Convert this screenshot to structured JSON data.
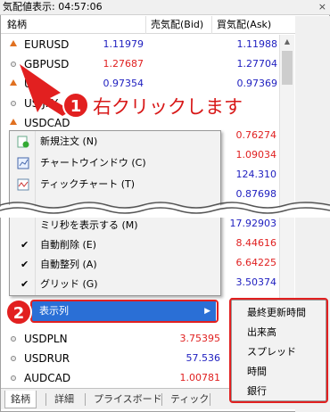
{
  "window": {
    "title": "気配値表示: 04:57:06",
    "close": "×"
  },
  "columns": {
    "symbol": "銘柄",
    "bid": "売気配(Bid)",
    "ask": "買気配(Ask)"
  },
  "rows": [
    {
      "sym": "EURUSD",
      "bid": "1.11979",
      "ask": "1.11988",
      "bidc": "blue",
      "askc": "blue",
      "ind": "up"
    },
    {
      "sym": "GBPUSD",
      "bid": "1.27687",
      "ask": "1.27704",
      "bidc": "red",
      "askc": "blue",
      "ind": "dot"
    },
    {
      "sym": "U",
      "bid": "0.97354",
      "ask": "0.97369",
      "bidc": "blue",
      "askc": "blue",
      "ind": "up"
    },
    {
      "sym": "US JPY",
      "bid": "",
      "ask": "",
      "bidc": "blue",
      "askc": "blue",
      "ind": "dot"
    },
    {
      "sym": "USDCAD",
      "bid": "",
      "ask": "",
      "bidc": "blue",
      "askc": "blue",
      "ind": "up"
    }
  ],
  "hidden_asks": [
    {
      "v": "0.76274",
      "c": "red"
    },
    {
      "v": "1.09034",
      "c": "red"
    },
    {
      "v": "124.310",
      "c": "blue"
    },
    {
      "v": "0.87698",
      "c": "blue"
    },
    {
      "v": "17.92903",
      "c": "blue"
    },
    {
      "v": "8.44616",
      "c": "red"
    },
    {
      "v": "6.64225",
      "c": "red"
    },
    {
      "v": "3.50374",
      "c": "blue"
    },
    {
      "v": "12.82025",
      "c": "red"
    }
  ],
  "lower_rows": [
    {
      "sym": "USDPLN",
      "bid": "3.75395",
      "bidc": "red",
      "grey": false
    },
    {
      "sym": "USDRUR",
      "bid": "57.536",
      "bidc": "blue",
      "grey": true
    },
    {
      "sym": "AUDCAD",
      "bid": "1.00781",
      "bidc": "red",
      "grey": false
    }
  ],
  "context_menu": {
    "new_order": "新規注文 (N)",
    "chart_window": "チャートウインドウ (C)",
    "tick_chart": "ティックチャート (T)",
    "show_ms": "ミリ秒を表示する (M)",
    "auto_remove": "自動削除 (E)",
    "auto_arrange": "自動整列 (A)",
    "grid": "グリッド (G)",
    "columns": "表示列"
  },
  "submenu": [
    "最終更新時間",
    "出来高",
    "スプレッド",
    "時間",
    "銀行"
  ],
  "tabs": [
    "銘柄",
    "詳細",
    "プライスボード",
    "ティック"
  ],
  "callouts": {
    "step1_num": "1",
    "step1_text": "右クリックします",
    "step2_num": "2"
  },
  "colors": {
    "accent_red": "#e22020",
    "highlight": "#2a6fd6"
  }
}
